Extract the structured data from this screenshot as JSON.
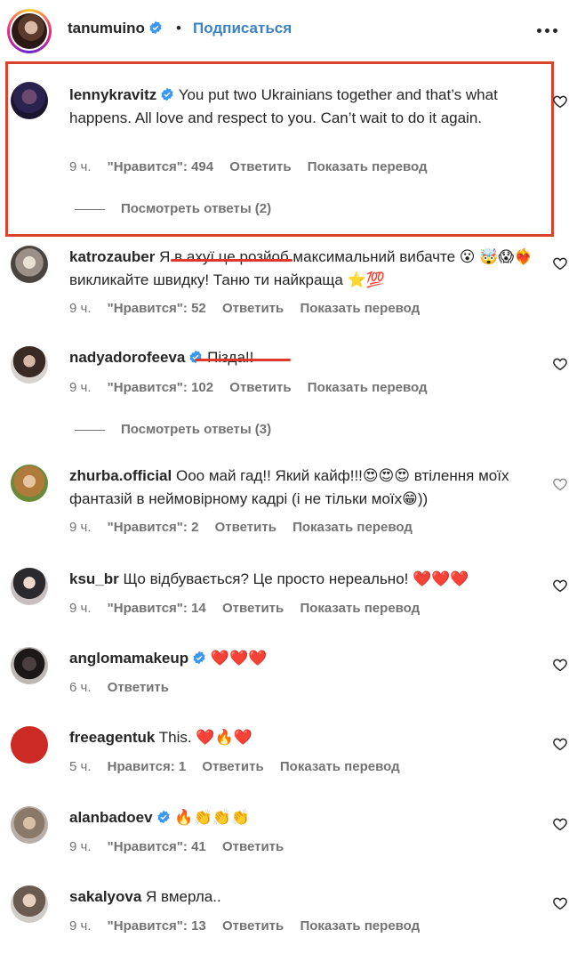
{
  "post": {
    "username": "tanumuino",
    "separator": "•",
    "follow_label": "Подписаться"
  },
  "colors": {
    "link_blue": "#3b82c4",
    "highlight_red": "#d9432e",
    "heart_red": "#e0242c",
    "verified_blue": "#3897f0"
  },
  "comments": [
    {
      "username": "lennykravitz",
      "verified": true,
      "text": "You put two Ukrainians together and that’s what happens. All love and respect to you. Can’t wait to do it again.",
      "time": "9 ч.",
      "likes": "\"Нравится\": 494",
      "reply": "Ответить",
      "translate": "Показать перевод",
      "view_replies": "Посмотреть ответы (2)"
    },
    {
      "username": "katrozauber",
      "verified": false,
      "text_before_strike": "Я ",
      "text_struck": "в ахуї це розйоб",
      "text_after_strike": " максимальний вибачте 😮 🤯😱❤️‍🔥 викликайте швидку! Таню ти найкраща ⭐💯",
      "time": "9 ч.",
      "likes": "\"Нравится\": 52",
      "reply": "Ответить",
      "translate": "Показать перевод"
    },
    {
      "username": "nadyadorofeeva",
      "verified": true,
      "text_struck": "Піздa!!",
      "time": "9 ч.",
      "likes": "\"Нравится\": 102",
      "reply": "Ответить",
      "translate": "Показать перевод",
      "view_replies": "Посмотреть ответы (3)"
    },
    {
      "username": "zhurba.official",
      "verified": false,
      "text": "Ооо май гад!! Який кайф!!!😍😍😍 втілення моїх фантазій в неймовірному кадрі (і не тільки моїх😁))",
      "time": "9 ч.",
      "likes": "\"Нравится\": 2",
      "reply": "Ответить",
      "translate": "Показать перевод"
    },
    {
      "username": "ksu_br",
      "verified": false,
      "text": "Що відбувається? Це просто нереально! ❤️❤️❤️",
      "time": "9 ч.",
      "likes": "\"Нравится\": 14",
      "reply": "Ответить",
      "translate": "Показать перевод"
    },
    {
      "username": "anglomamakeup",
      "verified": true,
      "text": "❤️❤️❤️",
      "time": "6 ч.",
      "reply": "Ответить"
    },
    {
      "username": "freeagentuk",
      "verified": false,
      "text": "This. ❤️🔥❤️",
      "time": "5 ч.",
      "likes": "Нравится: 1",
      "reply": "Ответить",
      "translate": "Показать перевод"
    },
    {
      "username": "alanbadoev",
      "verified": true,
      "text": "🔥👏👏👏",
      "time": "9 ч.",
      "likes": "\"Нравится\": 41",
      "reply": "Ответить"
    },
    {
      "username": "sakalyova",
      "verified": false,
      "text": "Я вмерла..",
      "time": "9 ч.",
      "likes": "\"Нравится\": 13",
      "reply": "Ответить",
      "translate": "Показать перевод"
    }
  ]
}
